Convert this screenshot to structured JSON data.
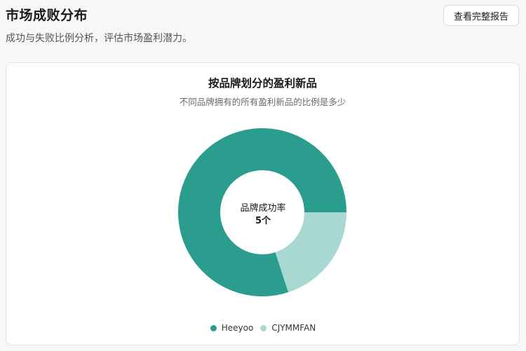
{
  "header": {
    "title": "市场成败分布",
    "subtitle": "成功与失败比例分析，评估市场盈利潜力。",
    "report_button": "查看完整报告"
  },
  "chart_data": {
    "type": "pie",
    "title": "按品牌划分的盈利新品",
    "subtitle": "不同品牌拥有的所有盈利新品的比例是多少",
    "center_label": "品牌成功率",
    "center_value": "5个",
    "categories": [
      "Heeyoo",
      "CJYMMFAN"
    ],
    "values": [
      4,
      1
    ],
    "colors": [
      "#2a9d8f",
      "#a8d8d1"
    ],
    "legend_position": "bottom-center"
  }
}
